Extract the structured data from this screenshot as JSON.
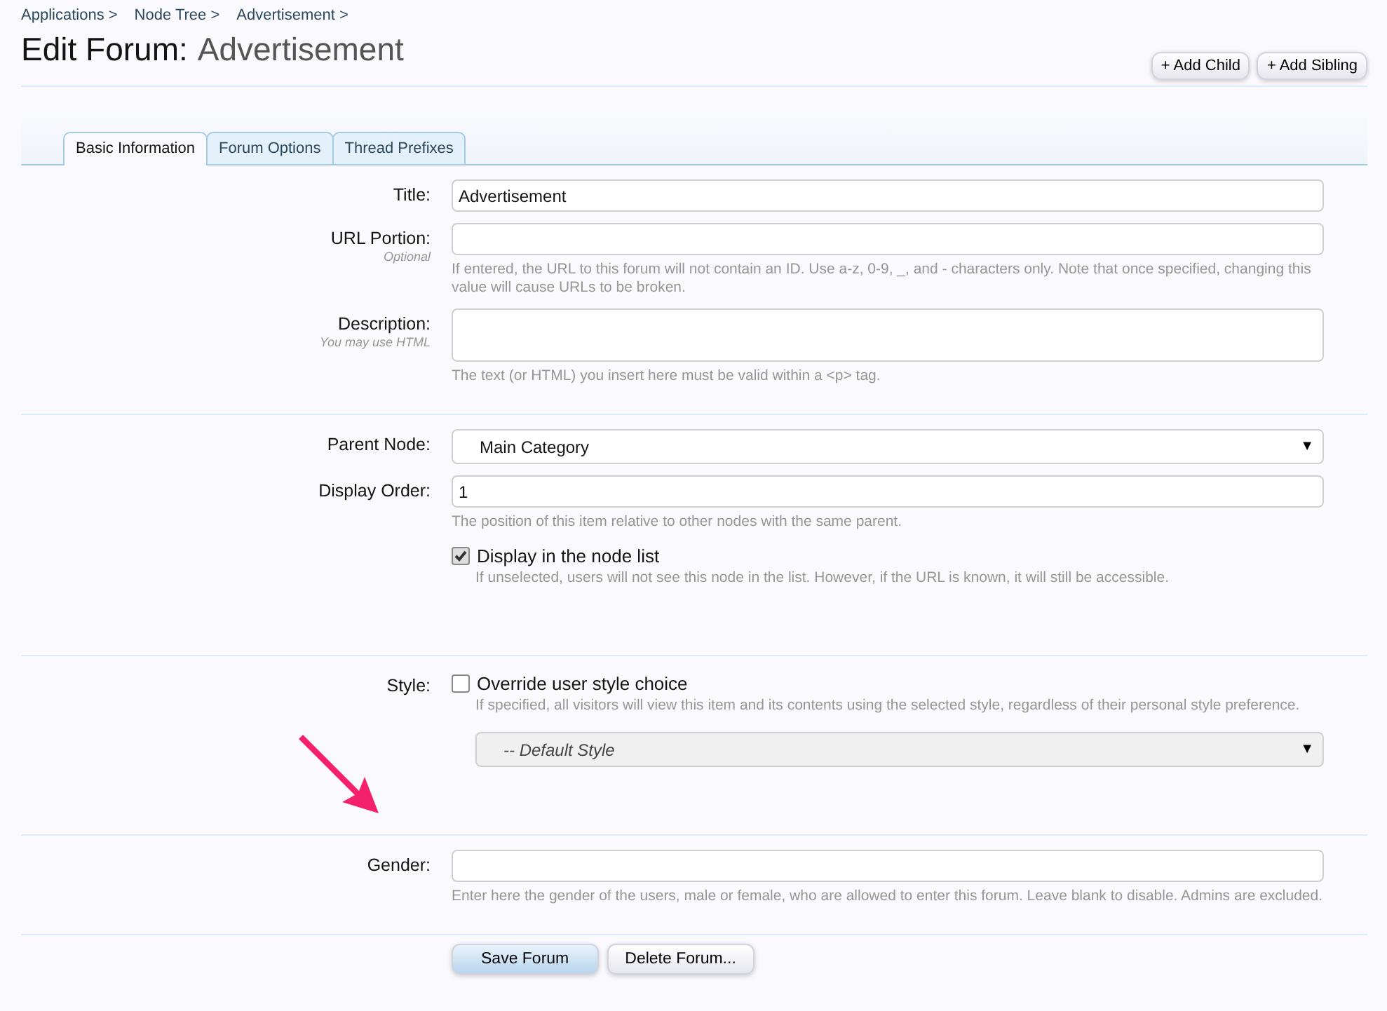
{
  "breadcrumb": [
    "Applications >",
    "Node Tree >",
    "Advertisement >"
  ],
  "heading": {
    "prefix": "Edit Forum:",
    "name": "Advertisement"
  },
  "header_buttons": [
    "+ Add Child",
    "+ Add Sibling"
  ],
  "tabs": [
    {
      "label": "Basic Information",
      "selected": true
    },
    {
      "label": "Forum Options",
      "selected": false
    },
    {
      "label": "Thread Prefixes",
      "selected": false
    }
  ],
  "sections": [
    {
      "rows": [
        {
          "kind": "text",
          "label": "Title:",
          "value": "Advertisement"
        },
        {
          "kind": "text",
          "label": "URL Portion:",
          "sublabel": "Optional",
          "hint": "If entered, the URL to this forum will not contain an ID. Use a-z, 0-9, _, and - characters only. Note that once specified, changing this value will cause URLs to be broken."
        },
        {
          "kind": "textarea",
          "label": "Description:",
          "sublabel": "You may use HTML",
          "hint": "The text (or HTML) you insert here must be valid within a <p> tag."
        }
      ]
    },
    {
      "rows": [
        {
          "kind": "select",
          "label": "Parent Node:",
          "value": "Main Category",
          "arrow": "▼"
        },
        {
          "kind": "text",
          "label": "Display Order:",
          "value": "1",
          "hint": "The position of this item relative to other nodes with the same parent."
        },
        {
          "kind": "checkbox",
          "text": "Display in the node list",
          "checked": true,
          "hint": "If unselected, users will not see this node in the list. However, if the URL is known, it will still be accessible."
        }
      ]
    },
    {
      "rows": [
        {
          "kind": "checkbox",
          "label": "Style:",
          "text": "Override user style choice",
          "checked": false,
          "hint": "If specified, all visitors will view this item and its contents using the selected style, regardless of their personal style preference.",
          "select": {
            "value": "-- Default Style",
            "arrow": "▼",
            "disabled": true
          }
        }
      ]
    },
    {
      "rows": [
        {
          "kind": "text",
          "label": "Gender:",
          "hint": "Enter here the gender of the users, male or female, who are allowed to enter this forum. Leave blank to disable. Admins are excluded."
        }
      ]
    }
  ],
  "buttons": [
    {
      "label": "Save Forum",
      "kind": "primary"
    },
    {
      "label": "Delete Forum...",
      "kind": "secondary"
    }
  ]
}
